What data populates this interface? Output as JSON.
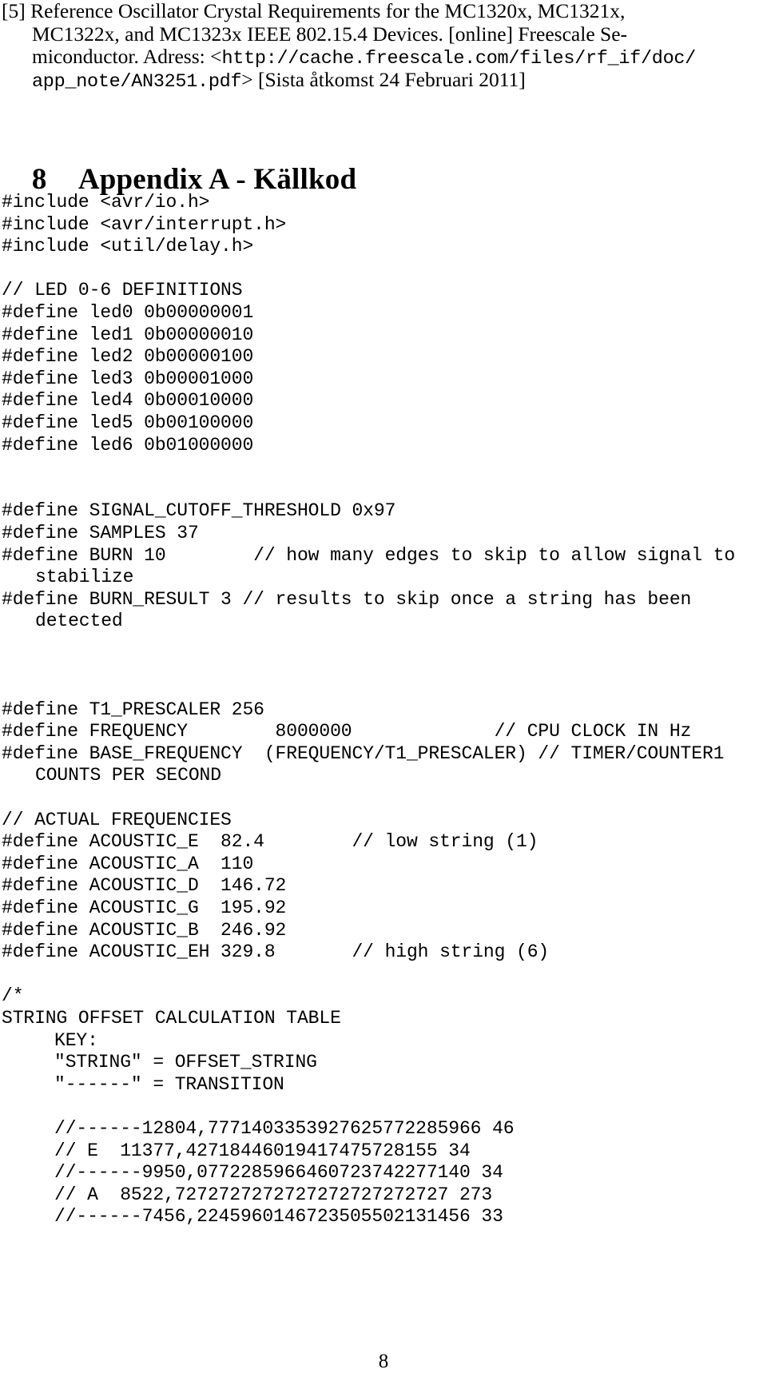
{
  "bibliography": {
    "label": "[5]",
    "lines": [
      {
        "segments": [
          {
            "text": "[5] Reference Oscillator Crystal Requirements for the MC1320x, MC1321x,",
            "mono": false
          }
        ]
      },
      {
        "segments": [
          {
            "text": "MC1322x, and MC1323x IEEE 802.15.4 Devices. [online] Freescale Se-",
            "mono": false
          }
        ]
      },
      {
        "segments": [
          {
            "text": "miconductor. Adress: <",
            "mono": false
          },
          {
            "text": "http://cache.freescale.com/files/rf_if/doc/",
            "mono": true
          }
        ]
      },
      {
        "segments": [
          {
            "text": "app_note/AN3251.pdf",
            "mono": true
          },
          {
            "text": "> [Sista åtkomst 24 Februari 2011]",
            "mono": false
          }
        ]
      }
    ]
  },
  "heading": {
    "number": "8",
    "title": "Appendix A - Källkod"
  },
  "code": {
    "lines": [
      {
        "text": "#include <avr/io.h>",
        "indent": 0
      },
      {
        "text": "#include <avr/interrupt.h>",
        "indent": 0
      },
      {
        "text": "#include <util/delay.h>",
        "indent": 0
      },
      {
        "text": "",
        "indent": 0
      },
      {
        "text": "// LED 0-6 DEFINITIONS",
        "indent": 0
      },
      {
        "text": "#define led0 0b00000001",
        "indent": 0
      },
      {
        "text": "#define led1 0b00000010",
        "indent": 0
      },
      {
        "text": "#define led2 0b00000100",
        "indent": 0
      },
      {
        "text": "#define led3 0b00001000",
        "indent": 0
      },
      {
        "text": "#define led4 0b00010000",
        "indent": 0
      },
      {
        "text": "#define led5 0b00100000",
        "indent": 0
      },
      {
        "text": "#define led6 0b01000000",
        "indent": 0
      },
      {
        "text": "",
        "indent": 0
      },
      {
        "text": "",
        "indent": 0
      },
      {
        "text": "#define SIGNAL_CUTOFF_THRESHOLD 0x97",
        "indent": 0
      },
      {
        "text": "#define SAMPLES 37",
        "indent": 0
      },
      {
        "text": "#define BURN 10        // how many edges to skip to allow signal to",
        "indent": 0
      },
      {
        "text": "stabilize",
        "indent": 1
      },
      {
        "text": "#define BURN_RESULT 3 // results to skip once a string has been",
        "indent": 0
      },
      {
        "text": "detected",
        "indent": 1
      },
      {
        "text": "",
        "indent": 0
      },
      {
        "text": "",
        "indent": 0
      },
      {
        "text": "",
        "indent": 0
      },
      {
        "text": "#define T1_PRESCALER 256",
        "indent": 0
      },
      {
        "text": "#define FREQUENCY        8000000             // CPU CLOCK IN Hz",
        "indent": 0
      },
      {
        "text": "#define BASE_FREQUENCY  (FREQUENCY/T1_PRESCALER) // TIMER/COUNTER1",
        "indent": 0
      },
      {
        "text": "COUNTS PER SECOND",
        "indent": 1
      },
      {
        "text": "",
        "indent": 0
      },
      {
        "text": "// ACTUAL FREQUENCIES",
        "indent": 0
      },
      {
        "text": "#define ACOUSTIC_E  82.4        // low string (1)",
        "indent": 0
      },
      {
        "text": "#define ACOUSTIC_A  110",
        "indent": 0
      },
      {
        "text": "#define ACOUSTIC_D  146.72",
        "indent": 0
      },
      {
        "text": "#define ACOUSTIC_G  195.92",
        "indent": 0
      },
      {
        "text": "#define ACOUSTIC_B  246.92",
        "indent": 0
      },
      {
        "text": "#define ACOUSTIC_EH 329.8       // high string (6)",
        "indent": 0
      },
      {
        "text": "",
        "indent": 0
      },
      {
        "text": "/*",
        "indent": 0
      },
      {
        "text": "STRING OFFSET CALCULATION TABLE",
        "indent": 0
      },
      {
        "text": "KEY:",
        "indent": 2
      },
      {
        "text": "\"STRING\" = OFFSET_STRING",
        "indent": 2
      },
      {
        "text": "\"------\" = TRANSITION",
        "indent": 2
      },
      {
        "text": "",
        "indent": 0
      },
      {
        "text": "//------12804,7771403353927625772285966 46",
        "indent": 2
      },
      {
        "text": "// E  11377,42718446019417475728155 34",
        "indent": 2
      },
      {
        "text": "//------9950,0772285966460723742277140 34",
        "indent": 2
      },
      {
        "text": "// A  8522,7272727272727272727272727 273",
        "indent": 2
      },
      {
        "text": "//------7456,2245960146723505502131456 33",
        "indent": 2
      }
    ]
  },
  "footer": {
    "page_number": "8"
  }
}
